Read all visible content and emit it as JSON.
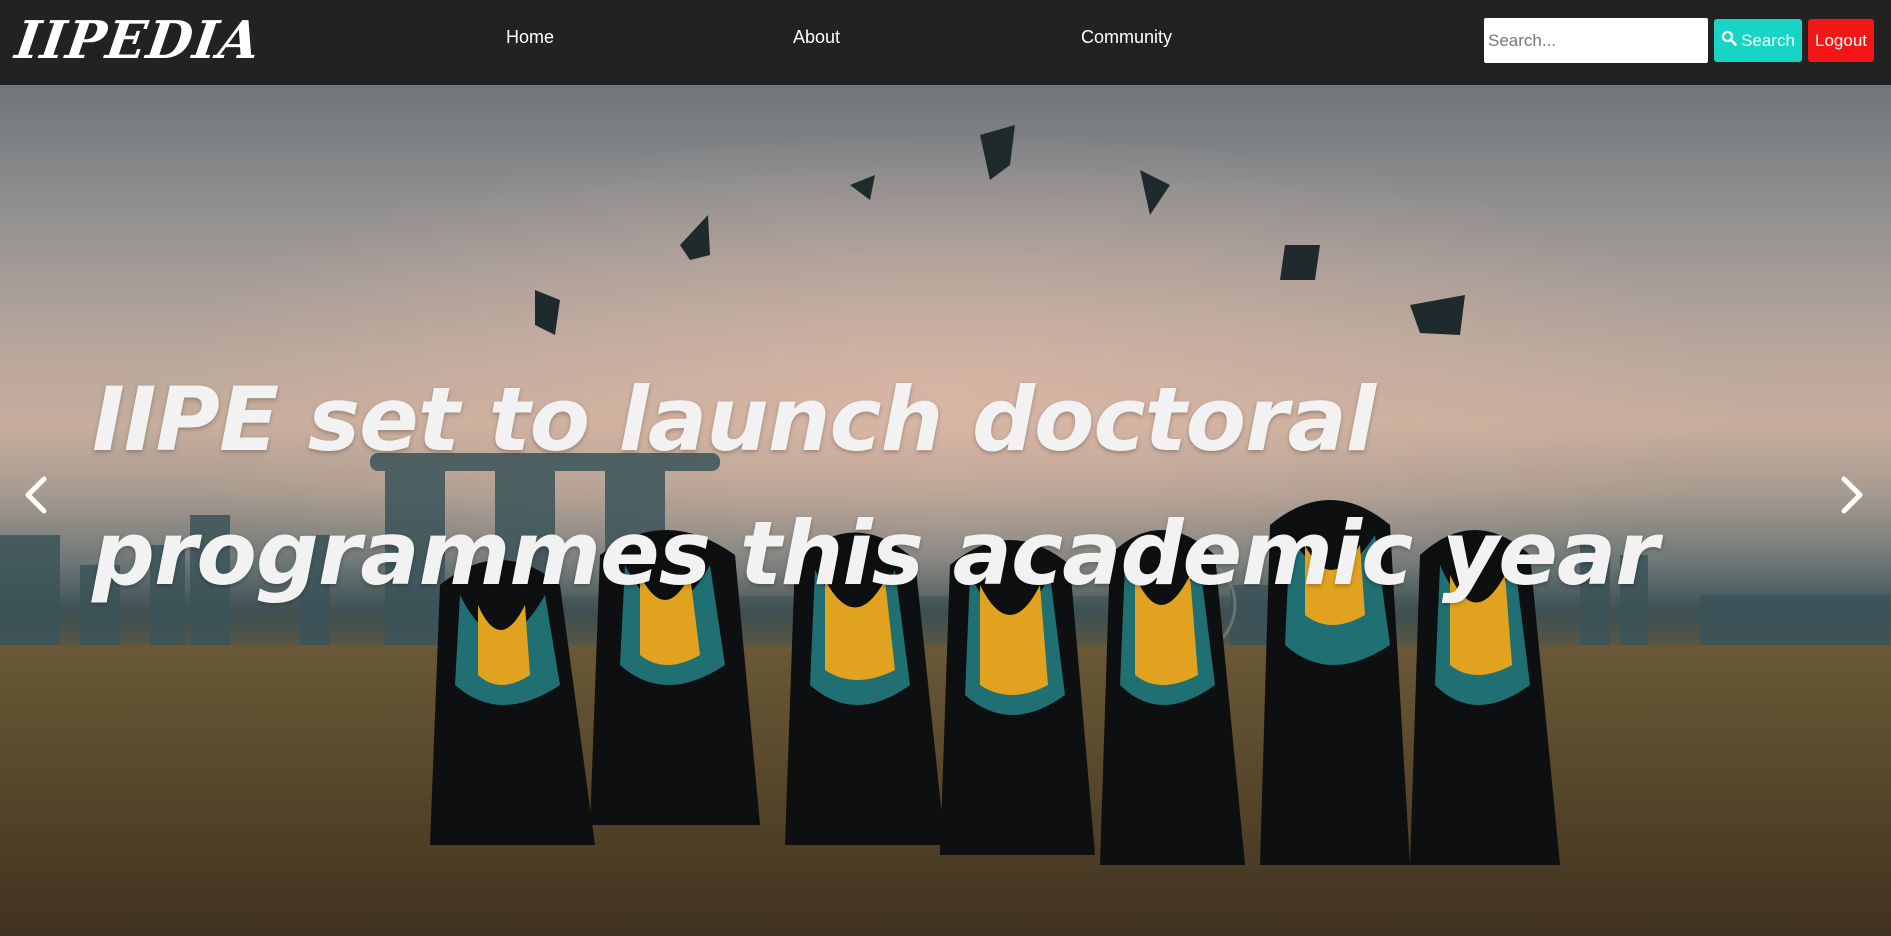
{
  "navbar": {
    "logo": "IIPEDIA",
    "links": [
      {
        "label": "Home"
      },
      {
        "label": "About"
      },
      {
        "label": "Community"
      }
    ],
    "search": {
      "placeholder": "Search...",
      "button_label": "Search",
      "button_icon": "search-icon"
    },
    "logout_label": "Logout"
  },
  "hero": {
    "caption": "IIPE set to launch doctoral programmes this academic year",
    "prev_icon": "chevron-left-icon",
    "next_icon": "chevron-right-icon"
  },
  "colors": {
    "navbar_bg": "#222222",
    "search_button": "#17d4c5",
    "logout_button": "#f21616",
    "caption_text": "#f2f2f2"
  }
}
